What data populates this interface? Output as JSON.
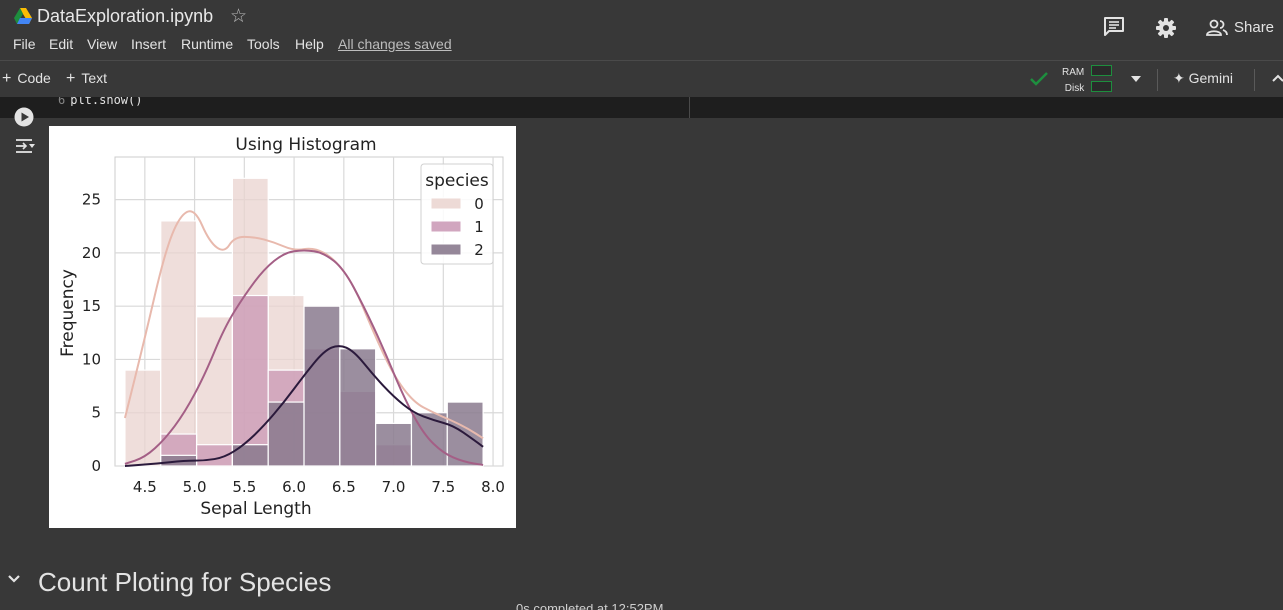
{
  "header": {
    "title": "DataExploration.ipynb",
    "menu": [
      "File",
      "Edit",
      "View",
      "Insert",
      "Runtime",
      "Tools",
      "Help"
    ],
    "save_status": "All changes saved",
    "share_label": "Share",
    "icons": [
      "drive-logo",
      "star-icon",
      "comment-icon",
      "settings-gear-icon",
      "share-people-icon"
    ]
  },
  "toolbar": {
    "add_code": "Code",
    "add_text": "Text",
    "ram_label": "RAM",
    "disk_label": "Disk",
    "gemini_label": "Gemini",
    "status_color": "#1e8e3e"
  },
  "cell": {
    "line_number": "6",
    "code": "plt.show()"
  },
  "chart_data": {
    "type": "histogram",
    "title": "Using Histogram",
    "xlabel": "Sepal Length",
    "ylabel": "Frequency",
    "xlim": [
      4.2,
      8.1
    ],
    "ylim": [
      0,
      29
    ],
    "xticks": [
      "4.5",
      "5.0",
      "5.5",
      "6.0",
      "6.5",
      "7.0",
      "7.5",
      "8.0"
    ],
    "yticks": [
      "0",
      "5",
      "10",
      "15",
      "20",
      "25"
    ],
    "grid": true,
    "legend": {
      "title": "species",
      "placement": "top-right",
      "entries": [
        "0",
        "1",
        "2"
      ]
    },
    "bin_edges": [
      4.3,
      4.66,
      5.02,
      5.38,
      5.74,
      6.1,
      6.46,
      6.82,
      7.18,
      7.54,
      7.9
    ],
    "series": [
      {
        "name": "0",
        "values": [
          9,
          23,
          14,
          27,
          16,
          0,
          0,
          0,
          0,
          0
        ],
        "color": "#ead3cf",
        "kde": [
          [
            4.3,
            4.5
          ],
          [
            4.5,
            12
          ],
          [
            4.7,
            20
          ],
          [
            4.85,
            23.5
          ],
          [
            5.0,
            24.2
          ],
          [
            5.15,
            21
          ],
          [
            5.3,
            20
          ],
          [
            5.4,
            21.5
          ],
          [
            5.6,
            21.5
          ],
          [
            5.8,
            21
          ],
          [
            6.0,
            20.2
          ],
          [
            6.2,
            20.5
          ],
          [
            6.4,
            19.5
          ],
          [
            6.6,
            17
          ],
          [
            6.8,
            12.5
          ],
          [
            7.0,
            8.5
          ],
          [
            7.2,
            6
          ],
          [
            7.4,
            5
          ],
          [
            7.6,
            4.2
          ],
          [
            7.75,
            3.5
          ],
          [
            7.9,
            2.6
          ]
        ]
      },
      {
        "name": "1",
        "values": [
          0,
          3,
          2,
          16,
          9,
          11,
          7,
          2,
          0,
          0
        ],
        "color": "#c997b4",
        "kde": [
          [
            4.3,
            0.2
          ],
          [
            4.5,
            0.8
          ],
          [
            4.7,
            2.5
          ],
          [
            4.9,
            5
          ],
          [
            5.1,
            8.5
          ],
          [
            5.3,
            13
          ],
          [
            5.5,
            16
          ],
          [
            5.7,
            18.5
          ],
          [
            5.9,
            20
          ],
          [
            6.1,
            20.3
          ],
          [
            6.3,
            20
          ],
          [
            6.5,
            18.5
          ],
          [
            6.7,
            15
          ],
          [
            6.9,
            11
          ],
          [
            7.1,
            6.5
          ],
          [
            7.3,
            3
          ],
          [
            7.5,
            1.2
          ],
          [
            7.7,
            0.4
          ],
          [
            7.9,
            0.1
          ]
        ]
      },
      {
        "name": "2",
        "values": [
          0,
          1,
          0,
          2,
          6,
          15,
          11,
          4,
          5,
          6
        ],
        "color": "#8a7a8e",
        "kde": [
          [
            4.3,
            0
          ],
          [
            4.6,
            0.2
          ],
          [
            4.9,
            0.5
          ],
          [
            5.1,
            0.5
          ],
          [
            5.3,
            0.8
          ],
          [
            5.5,
            2
          ],
          [
            5.7,
            3.8
          ],
          [
            5.9,
            6
          ],
          [
            6.1,
            8.5
          ],
          [
            6.3,
            10.8
          ],
          [
            6.45,
            11.4
          ],
          [
            6.6,
            10.8
          ],
          [
            6.8,
            8.5
          ],
          [
            7.0,
            6.5
          ],
          [
            7.2,
            5
          ],
          [
            7.4,
            4.3
          ],
          [
            7.6,
            3.8
          ],
          [
            7.8,
            2.5
          ],
          [
            7.9,
            1.8
          ]
        ]
      }
    ],
    "kde_colors": [
      "#e8b9ad",
      "#a45f86",
      "#2b1a3c"
    ]
  },
  "section": {
    "title": "Count Ploting for Species",
    "bottom_status": "0s completed at 12:52PM"
  }
}
